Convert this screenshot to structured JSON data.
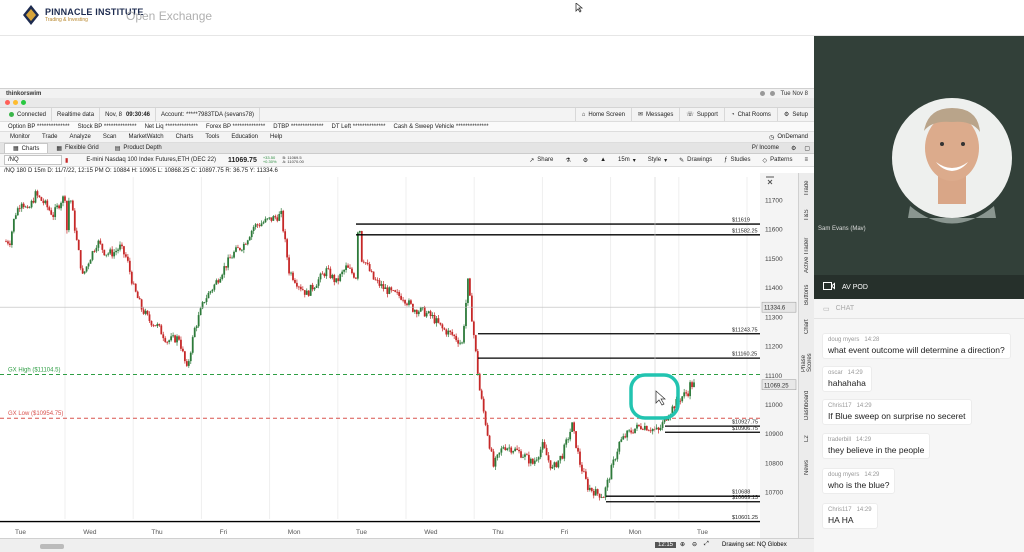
{
  "header": {
    "logo_name": "PINNACLE INSTITUTE",
    "logo_tagline": "Trading & Investing",
    "page_title": "Open Exchange"
  },
  "platform": {
    "mac_app": "thinkorswim",
    "mac_time": "Tue Nov 8",
    "status": {
      "connected": "Connected",
      "realtime": "Realtime data",
      "date": "Nov, 8",
      "time": "09:30:46",
      "account": "Account: *****7983TDA (sevans78)",
      "home_screen": "Home Screen",
      "messages": "Messages",
      "support": "Support",
      "chat_rooms": "Chat Rooms",
      "setup": "Setup"
    },
    "balances": [
      {
        "label": "Option BP",
        "value": "**************"
      },
      {
        "label": "Stock BP",
        "value": "**************"
      },
      {
        "label": "Net Liq",
        "value": "**************"
      },
      {
        "label": "Forex BP",
        "value": "**************"
      },
      {
        "label": "DTBP",
        "value": "**************"
      },
      {
        "label": "DT Left",
        "value": "**************"
      },
      {
        "label": "Cash & Sweep Vehicle",
        "value": "**************"
      }
    ],
    "menu": [
      "Monitor",
      "Trade",
      "Analyze",
      "Scan",
      "MarketWatch",
      "Charts",
      "Tools",
      "Education",
      "Help"
    ],
    "ondemand": "OnDemand",
    "chart_tabs": [
      "Charts",
      "Flexible Grid",
      "Product Depth"
    ],
    "pl_label": "P/ Income",
    "symbol": {
      "input": "/NQ",
      "description": "E-mini Nasdaq 100 Index Futures,ETH (DEC 22)",
      "last": "11069.75",
      "change": "+33.50",
      "change_pct": "+0.30%",
      "bid": "B: 11069.5",
      "ask": "A: 11070.00"
    },
    "toolbar": {
      "share": "Share",
      "interval": "15m",
      "style": "Style",
      "drawings": "Drawings",
      "studies": "Studies",
      "patterns": "Patterns"
    },
    "ohlc": "/NQ 180 D 15m  D: 11/7/22, 12:15 PM  O: 10884  H: 10905  L: 10868.25  C: 10897.75  R: 36.75  Y: 11334.6",
    "side_tabs": [
      "Trade",
      "T&S",
      "Active Trader",
      "Buttons",
      "Chart",
      "Phase Scores",
      "Dashboard",
      "L2",
      "News"
    ],
    "drawing_set": "Drawing set: NQ Globex",
    "bottom_time": "12:15"
  },
  "chart_data": {
    "type": "candlestick",
    "x_labels": [
      "Tue",
      "Wed",
      "Thu",
      "Fri",
      "Mon",
      "Tue",
      "Wed",
      "Thu",
      "Fri",
      "Mon",
      "Tue"
    ],
    "ylim": [
      10610,
      11780
    ],
    "y_ticks": [
      11700,
      11600,
      11500,
      11400,
      11300,
      11200,
      11100,
      11000,
      10900,
      10800,
      10700
    ],
    "current_price_label": "11069.25",
    "crosshair_price_label": "11334.6",
    "levels": [
      {
        "label": "$11619",
        "value": 11619,
        "color": "#000000"
      },
      {
        "label": "$11582.25",
        "value": 11582.25,
        "color": "#000000"
      },
      {
        "label": "$11243.75",
        "value": 11243.75,
        "color": "#000000"
      },
      {
        "label": "$11160.25",
        "value": 11160.25,
        "color": "#000000"
      },
      {
        "label": "$10927.75",
        "value": 10927.75,
        "color": "#000000"
      },
      {
        "label": "$10906.75",
        "value": 10906.75,
        "color": "#000000"
      },
      {
        "label": "$10688",
        "value": 10688,
        "color": "#000000"
      },
      {
        "label": "$10669.13",
        "value": 10669.13,
        "color": "#000000"
      },
      {
        "label": "$10601.25",
        "value": 10601.25,
        "color": "#000000"
      }
    ],
    "gx_high": {
      "label": "GX High ($11104.5)",
      "value": 11104.5,
      "color": "#2e9e44"
    },
    "gx_low": {
      "label": "GX Low ($10954.75)",
      "value": 10954.75,
      "color": "#d9534f"
    },
    "price_path": [
      [
        0,
        11480
      ],
      [
        0.4,
        11560
      ],
      [
        0.9,
        11650
      ],
      [
        1.6,
        11700
      ],
      [
        2.2,
        11660
      ],
      [
        3.0,
        11720
      ],
      [
        3.9,
        11690
      ],
      [
        4.8,
        11650
      ],
      [
        5.6,
        11700
      ],
      [
        6.2,
        11720
      ],
      [
        6.3,
        11600
      ],
      [
        6.6,
        11700
      ],
      [
        7.2,
        11560
      ],
      [
        7.8,
        11440
      ],
      [
        8.5,
        11500
      ],
      [
        9.3,
        11560
      ],
      [
        10.1,
        11520
      ],
      [
        10.9,
        11520
      ],
      [
        11.6,
        11540
      ],
      [
        12.3,
        11500
      ],
      [
        13.0,
        11400
      ],
      [
        13.8,
        11330
      ],
      [
        14.6,
        11290
      ],
      [
        15.4,
        11270
      ],
      [
        16.4,
        11220
      ],
      [
        17.6,
        11230
      ],
      [
        18.4,
        11120
      ],
      [
        19.2,
        11260
      ],
      [
        20.2,
        11360
      ],
      [
        21.2,
        11410
      ],
      [
        22.2,
        11470
      ],
      [
        23.2,
        11520
      ],
      [
        24.2,
        11550
      ],
      [
        25.2,
        11610
      ],
      [
        26.5,
        11630
      ],
      [
        28.0,
        11650
      ],
      [
        28.8,
        11460
      ],
      [
        29.6,
        11420
      ],
      [
        30.6,
        11380
      ],
      [
        31.6,
        11420
      ],
      [
        32.6,
        11460
      ],
      [
        33.6,
        11420
      ],
      [
        34.6,
        11470
      ],
      [
        35.6,
        11440
      ],
      [
        36.0,
        11600
      ],
      [
        36.4,
        11500
      ],
      [
        37.4,
        11430
      ],
      [
        38.4,
        11400
      ],
      [
        39.4,
        11380
      ],
      [
        40.4,
        11370
      ],
      [
        41.4,
        11330
      ],
      [
        42.4,
        11320
      ],
      [
        43.4,
        11300
      ],
      [
        44.4,
        11260
      ],
      [
        45.4,
        11240
      ],
      [
        46.4,
        11210
      ],
      [
        47.0,
        11420
      ],
      [
        47.6,
        11240
      ],
      [
        48.2,
        11050
      ],
      [
        48.8,
        10940
      ],
      [
        49.6,
        10790
      ],
      [
        50.6,
        10860
      ],
      [
        51.6,
        10850
      ],
      [
        52.6,
        10830
      ],
      [
        53.6,
        10800
      ],
      [
        54.6,
        10860
      ],
      [
        55.6,
        10780
      ],
      [
        56.6,
        10830
      ],
      [
        57.6,
        10930
      ],
      [
        58.4,
        10800
      ],
      [
        59.2,
        10720
      ],
      [
        60.0,
        10700
      ],
      [
        60.8,
        10690
      ],
      [
        61.6,
        10780
      ],
      [
        62.4,
        10870
      ],
      [
        63.2,
        10900
      ],
      [
        64.0,
        10920
      ],
      [
        64.8,
        10930
      ],
      [
        65.6,
        10920
      ],
      [
        66.4,
        10910
      ],
      [
        67.2,
        10960
      ],
      [
        68.0,
        11000
      ],
      [
        68.8,
        11030
      ],
      [
        69.6,
        11050
      ],
      [
        70.0,
        11069
      ]
    ]
  },
  "right_panel": {
    "presenter_name": "Sam Evans (Mav)",
    "av_pod": "AV POD",
    "chat_label": "CHAT",
    "messages": [
      {
        "user": "doug myers",
        "time": "14:28",
        "text": "what event outcome will determine a direction?"
      },
      {
        "user": "oscar",
        "time": "14:29",
        "text": "hahahaha"
      },
      {
        "user": "Chris117",
        "time": "14:29",
        "text": "If Blue sweep on surprise no seceret"
      },
      {
        "user": "traderbill",
        "time": "14:29",
        "text": "they believe in the people"
      },
      {
        "user": "doug myers",
        "time": "14:29",
        "text": "who is the blue?"
      },
      {
        "user": "Chris117",
        "time": "14:29",
        "text": "HA HA"
      }
    ]
  },
  "colors": {
    "up_candle": "#2d7a3a",
    "down_candle": "#c62828",
    "highlight_circle": "#22c4b0",
    "video_bg": "#2f3b34",
    "av_bar": "#26302b"
  }
}
